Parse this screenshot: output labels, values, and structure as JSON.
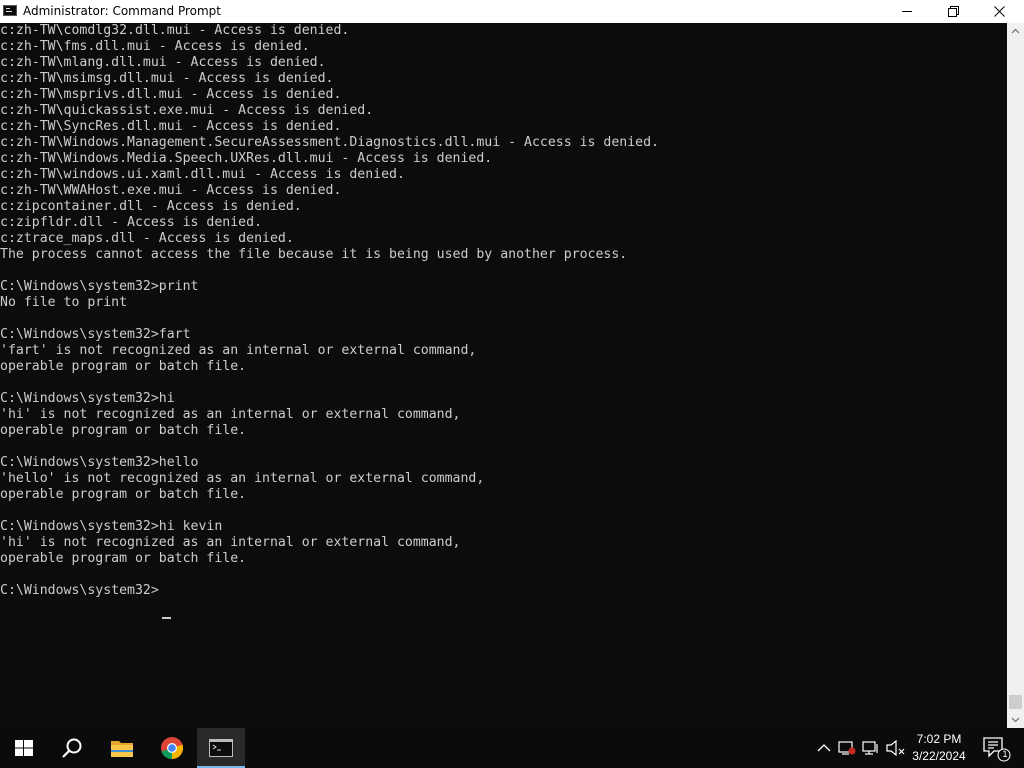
{
  "window": {
    "title": "Administrator: Command Prompt"
  },
  "console": {
    "lines": [
      "c:zh-TW\\comdlg32.dll.mui - Access is denied.",
      "c:zh-TW\\fms.dll.mui - Access is denied.",
      "c:zh-TW\\mlang.dll.mui - Access is denied.",
      "c:zh-TW\\msimsg.dll.mui - Access is denied.",
      "c:zh-TW\\msprivs.dll.mui - Access is denied.",
      "c:zh-TW\\quickassist.exe.mui - Access is denied.",
      "c:zh-TW\\SyncRes.dll.mui - Access is denied.",
      "c:zh-TW\\Windows.Management.SecureAssessment.Diagnostics.dll.mui - Access is denied.",
      "c:zh-TW\\Windows.Media.Speech.UXRes.dll.mui - Access is denied.",
      "c:zh-TW\\windows.ui.xaml.dll.mui - Access is denied.",
      "c:zh-TW\\WWAHost.exe.mui - Access is denied.",
      "c:zipcontainer.dll - Access is denied.",
      "c:zipfldr.dll - Access is denied.",
      "c:ztrace_maps.dll - Access is denied.",
      "The process cannot access the file because it is being used by another process.",
      "",
      "C:\\Windows\\system32>print",
      "No file to print",
      "",
      "C:\\Windows\\system32>fart",
      "'fart' is not recognized as an internal or external command,",
      "operable program or batch file.",
      "",
      "C:\\Windows\\system32>hi",
      "'hi' is not recognized as an internal or external command,",
      "operable program or batch file.",
      "",
      "C:\\Windows\\system32>hello",
      "'hello' is not recognized as an internal or external command,",
      "operable program or batch file.",
      "",
      "C:\\Windows\\system32>hi kevin",
      "'hi' is not recognized as an internal or external command,",
      "operable program or batch file.",
      "",
      "C:\\Windows\\system32>"
    ]
  },
  "taskbar": {
    "items": [
      {
        "name": "start",
        "icon": "windows-logo-icon"
      },
      {
        "name": "search",
        "icon": "search-icon"
      },
      {
        "name": "file-explorer",
        "icon": "folder-icon"
      },
      {
        "name": "google-chrome",
        "icon": "chrome-icon"
      },
      {
        "name": "command-prompt",
        "icon": "cmd-icon",
        "active": true
      }
    ],
    "tray": {
      "icons": [
        "chevron-up-icon",
        "network-icon",
        "display-icon",
        "speaker-muted-icon"
      ],
      "time": "7:02 PM",
      "date": "3/22/2024",
      "notification_count": "1"
    }
  },
  "colors": {
    "console_bg": "#0c0c0c",
    "console_fg": "#cccccc",
    "taskbar_bg": "#0b0b0b",
    "active_accent": "#76b9ed"
  }
}
